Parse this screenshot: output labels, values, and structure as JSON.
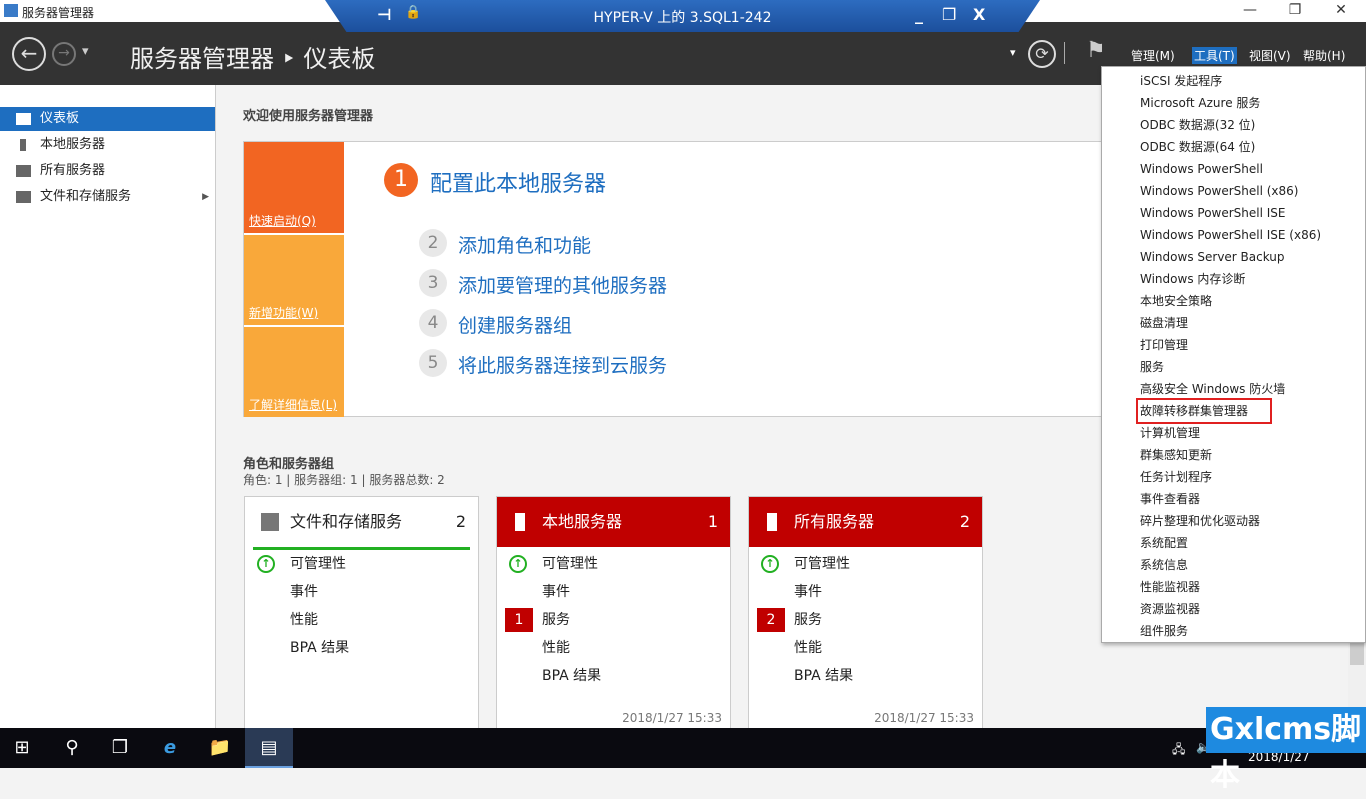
{
  "titlebar": {
    "title": "服务器管理器",
    "minimize": "—",
    "restore": "❐",
    "close": "✕"
  },
  "hyperv": {
    "title": "HYPER-V 上的 3.SQL1-242",
    "pin": "⊣",
    "lock": "🔒",
    "minimize": "_",
    "restore": "❐",
    "close": "X"
  },
  "header": {
    "breadcrumb": "服务器管理器 ‣ 仪表板",
    "back": "←",
    "forward": "→",
    "dropdown": "▾",
    "refresh": "⟳",
    "flag": "⚑",
    "menus": [
      "管理(M)",
      "工具(T)",
      "视图(V)",
      "帮助(H)"
    ],
    "active_menu": "工具(T)"
  },
  "sidebar": {
    "items": [
      {
        "label": "仪表板",
        "selected": true
      },
      {
        "label": "本地服务器"
      },
      {
        "label": "所有服务器"
      },
      {
        "label": "文件和存储服务",
        "arrow": "▶"
      }
    ]
  },
  "welcome": {
    "heading": "欢迎使用服务器管理器",
    "tiles": [
      "快速启动(Q)",
      "新增功能(W)",
      "了解详细信息(L)"
    ],
    "steps": [
      {
        "num": "1",
        "label": "配置此本地服务器"
      },
      {
        "num": "2",
        "label": "添加角色和功能"
      },
      {
        "num": "3",
        "label": "添加要管理的其他服务器"
      },
      {
        "num": "4",
        "label": "创建服务器组"
      },
      {
        "num": "5",
        "label": "将此服务器连接到云服务"
      }
    ]
  },
  "roles": {
    "heading": "角色和服务器组",
    "summary": "角色: 1 | 服务器组: 1 | 服务器总数: 2",
    "tiles": [
      {
        "title": "文件和存储服务",
        "count": "2",
        "rows": [
          {
            "label": "可管理性",
            "status": "ok"
          },
          {
            "label": "事件"
          },
          {
            "label": "性能"
          },
          {
            "label": "BPA 结果"
          }
        ],
        "time": ""
      },
      {
        "title": "本地服务器",
        "count": "1",
        "rows": [
          {
            "label": "可管理性",
            "status": "ok"
          },
          {
            "label": "事件"
          },
          {
            "label": "服务",
            "badge": "1"
          },
          {
            "label": "性能"
          },
          {
            "label": "BPA 结果"
          }
        ],
        "time": "2018/1/27 15:33"
      },
      {
        "title": "所有服务器",
        "count": "2",
        "rows": [
          {
            "label": "可管理性",
            "status": "ok"
          },
          {
            "label": "事件"
          },
          {
            "label": "服务",
            "badge": "2"
          },
          {
            "label": "性能"
          },
          {
            "label": "BPA 结果"
          }
        ],
        "time": "2018/1/27 15:33"
      }
    ]
  },
  "tools_menu": {
    "items": [
      "iSCSI 发起程序",
      "Microsoft Azure 服务",
      "ODBC 数据源(32 位)",
      "ODBC 数据源(64 位)",
      "Windows PowerShell",
      "Windows PowerShell (x86)",
      "Windows PowerShell ISE",
      "Windows PowerShell ISE (x86)",
      "Windows Server Backup",
      "Windows 内存诊断",
      "本地安全策略",
      "磁盘清理",
      "打印管理",
      "服务",
      "高级安全 Windows 防火墙",
      "故障转移群集管理器",
      "计算机管理",
      "群集感知更新",
      "任务计划程序",
      "事件查看器",
      "碎片整理和优化驱动器",
      "系统配置",
      "系统信息",
      "性能监视器",
      "资源监视器",
      "组件服务"
    ],
    "highlighted": "故障转移群集管理器"
  },
  "taskbar": {
    "start": "⊞",
    "search": "⚲",
    "taskview": "❐",
    "ie": "e",
    "explorer": "📁",
    "servermanager": "▤",
    "date": "2018/1/27",
    "network": "🖧",
    "volume": "🔈"
  },
  "watermark": "Gxlcms脚本",
  "colors": {
    "accent": "#1e6ec0",
    "orange": "#f26522",
    "red": "#c00000",
    "green": "#22b022"
  }
}
